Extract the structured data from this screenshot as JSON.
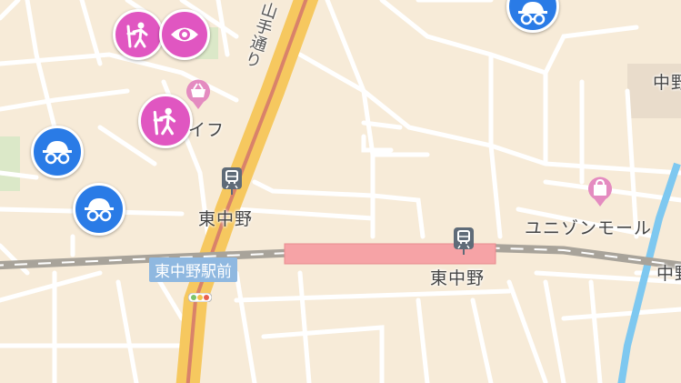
{
  "map": {
    "labels": {
      "station_west": "東中野",
      "station_east": "東中野",
      "bus_stop": "東中野駅前",
      "shopping": "ユニゾンモール",
      "life_fragment": "イフ",
      "road_name": "山手通り",
      "top_right_fragment": "中野",
      "right_edge_fragment": "中野"
    },
    "icons": {
      "station_west": "train-station-icon",
      "station_east": "train-station-icon",
      "shopping": "shopping-bag-icon",
      "basket": "shopping-basket-icon",
      "traffic_light": "traffic-light-icon"
    },
    "pins": [
      {
        "kind": "playground",
        "color": "#e056c1"
      },
      {
        "kind": "sightseeing",
        "color": "#e056c1"
      },
      {
        "kind": "playground",
        "color": "#e056c1"
      },
      {
        "kind": "incognito",
        "color": "#2a7be6"
      },
      {
        "kind": "incognito",
        "color": "#2a7be6"
      },
      {
        "kind": "incognito",
        "color": "#2a7be6"
      }
    ],
    "colors": {
      "background": "#f7ebd8",
      "major_road": "#f6c85f",
      "road_center": "#d9826a",
      "rail": "#a8a39a",
      "platform": "#f6a3a6",
      "water": "#7ec8f0",
      "pin_pink": "#e056c1",
      "pin_blue": "#2a7be6"
    }
  }
}
